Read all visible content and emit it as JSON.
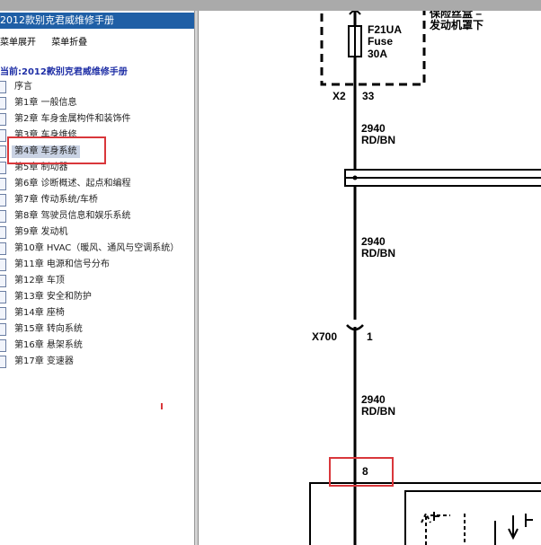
{
  "window": {
    "title": "2012款别克君威维修手册"
  },
  "toolbar": {
    "expand_label": "菜单展开",
    "collapse_label": "菜单折叠"
  },
  "current": {
    "label": "当前:2012款别克君威维修手册"
  },
  "tree": {
    "items": [
      {
        "label": "序言"
      },
      {
        "label": "第1章 一般信息"
      },
      {
        "label": "第2章 车身金属构件和装饰件"
      },
      {
        "label": "第3章 车身维修"
      },
      {
        "label": "第4章 车身系统",
        "selected": true
      },
      {
        "label": "第5章 制动器"
      },
      {
        "label": "第6章 诊断概述、起点和编程"
      },
      {
        "label": "第7章 传动系统/车桥"
      },
      {
        "label": "第8章 驾驶员信息和娱乐系统"
      },
      {
        "label": "第9章 发动机"
      },
      {
        "label": "第10章 HVAC（暖风、通风与空调系统）"
      },
      {
        "label": "第11章 电源和信号分布"
      },
      {
        "label": "第12章 车顶"
      },
      {
        "label": "第13章 安全和防护"
      },
      {
        "label": "第14章 座椅"
      },
      {
        "label": "第15章 转向系统"
      },
      {
        "label": "第16章 悬架系统"
      },
      {
        "label": "第17章 变速器"
      }
    ]
  },
  "diagram": {
    "top_text_1": "保险丝盒 –",
    "top_text_2": "发动机罩下",
    "fuse_name": "F21UA",
    "fuse_type": "Fuse",
    "fuse_rating": "30A",
    "x2_connector": "X2",
    "x2_pin": "33",
    "wire_1_circuit": "2940",
    "wire_1_color": "RD/BN",
    "wire_2_circuit": "2940",
    "wire_2_color": "RD/BN",
    "x700_connector": "X700",
    "x700_pin": "1",
    "wire_3_circuit": "2940",
    "wire_3_color": "RD/BN",
    "bottom_pin": "8"
  },
  "colors": {
    "title_bar": "#1f5fa6",
    "highlight": "#d9373b",
    "current_text": "#1f2fa6"
  }
}
